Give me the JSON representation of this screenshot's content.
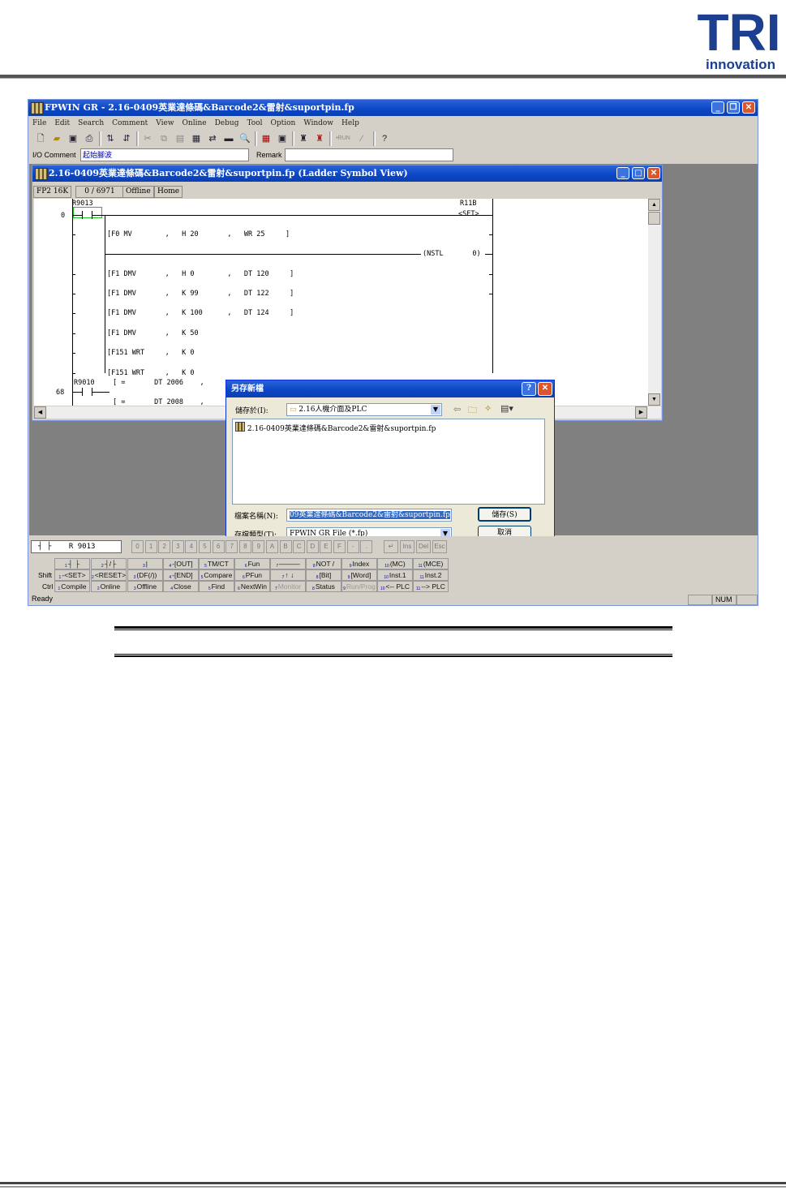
{
  "logo": {
    "main": "TRI",
    "sub": "innovation"
  },
  "app": {
    "title": "FPWIN GR - 2.16-0409英業達條碼&Barcode2&雷射&suportpin.fp",
    "menu": [
      "File",
      "Edit",
      "Search",
      "Comment",
      "View",
      "Online",
      "Debug",
      "Tool",
      "Option",
      "Window",
      "Help"
    ],
    "io_comment_label": "I/O Comment",
    "io_comment_value": "起始腳波",
    "remark_label": "Remark",
    "remark_value": ""
  },
  "ladder": {
    "title": "2.16-0409英業達條碼&Barcode2&雷射&suportpin.fp (Ladder Symbol View)",
    "status": [
      "FP2 16K",
      "0 / 6971",
      "Offline",
      "Home"
    ],
    "contacts": [
      "R9013",
      "R9010"
    ],
    "coil_label": "R11B",
    "coil_set": "<SET>",
    "row_nums": [
      "0",
      "68"
    ],
    "instructions": [
      "[F0 MV        ,   H 20       ,   WR 25     ]",
      "[F1 DMV       ,   H 0        ,   DT 120     ]",
      "[F1 DMV       ,   K 99       ,   DT 122     ]",
      "[F1 DMV       ,   K 100      ,   DT 124     ]",
      "[F1 DMV       ,   K 50",
      "[F151 WRT     ,   K 0",
      "[F151 WRT     ,   K 0"
    ],
    "nstl": "(NSTL       0)",
    "compare": [
      "[ =       DT 2006    ,",
      "[ =       DT 2008    ,"
    ]
  },
  "dialog": {
    "title": "另存新檔",
    "save_in_label": "儲存於(I):",
    "save_in_value": "2.16人機介面及PLC",
    "files": [
      "2.16-0409英業達條碼&Barcode2&雷射&suportpin.fp"
    ],
    "filename_label": "檔案名稱(N):",
    "filename_value": "09英業達條碼&Barcode2&雷射&suportpin.fp",
    "filetype_label": "存檔類型(T):",
    "filetype_value": "FPWIN GR File (*.fp)",
    "save_button": "儲存(S)",
    "cancel_button": "取消"
  },
  "keypanel": {
    "input_display": "┤ ├    R 9013",
    "num_keys": [
      "0",
      "1",
      "2",
      "3",
      "4",
      "5",
      "6",
      "7",
      "8",
      "9",
      "A",
      "B",
      "C",
      "D",
      "E",
      "F",
      "-",
      "."
    ],
    "edit_keys": [
      "↵",
      "Ins",
      "Del",
      "Esc"
    ],
    "row_labels": [
      "",
      "Shift",
      "Ctrl"
    ],
    "rows": [
      [
        "┤ ├",
        "┤/├",
        "|",
        "-[OUT]",
        "TM/CT",
        "Fun",
        "———",
        "NOT /",
        "Index",
        "(MC)",
        "(MCE)"
      ],
      [
        "-<SET>",
        "<RESET>",
        "(DF(/))",
        "-[END]",
        "Compare",
        "PFun",
        "↑ ↓",
        "[Bit]",
        "[Word]",
        "Inst.1",
        "Inst.2"
      ],
      [
        "Compile",
        "Online",
        "Offline",
        "Close",
        "Find",
        "NextWin",
        "Monitor",
        "Status",
        "Run/Prog",
        "<-- PLC",
        "--> PLC"
      ]
    ]
  },
  "statusbar": {
    "ready": "Ready",
    "num": "NUM"
  }
}
